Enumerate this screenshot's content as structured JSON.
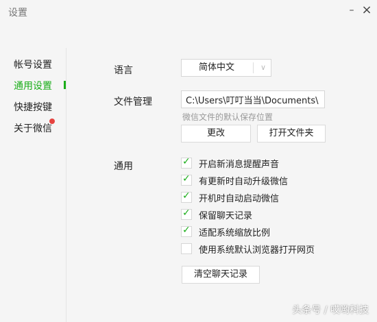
{
  "window": {
    "title": "设置",
    "minimize_glyph": "–",
    "close_glyph": "×"
  },
  "sidebar": {
    "items": [
      {
        "label": "帐号设置"
      },
      {
        "label": "通用设置"
      },
      {
        "label": "快捷按键"
      },
      {
        "label": "关于微信"
      }
    ],
    "active_index": 1
  },
  "language": {
    "label": "语言",
    "selected": "简体中文",
    "arrow_glyph": "∨"
  },
  "file_management": {
    "label": "文件管理",
    "path_value": "C:\\Users\\叮叮当当\\Documents\\",
    "hint": "微信文件的默认保存位置",
    "change_button": "更改",
    "open_folder_button": "打开文件夹"
  },
  "general": {
    "label": "通用",
    "options": [
      {
        "label": "开启新消息提醒声音",
        "checked": true
      },
      {
        "label": "有更新时自动升级微信",
        "checked": true
      },
      {
        "label": "开机时自动启动微信",
        "checked": true
      },
      {
        "label": "保留聊天记录",
        "checked": true
      },
      {
        "label": "适配系统缩放比例",
        "checked": true
      },
      {
        "label": "使用系统默认浏览器打开网页",
        "checked": false
      }
    ],
    "clear_button": "清空聊天记录"
  },
  "watermark": "头条号 / 哎哟科技",
  "colors": {
    "accent": "#1aad19",
    "badge": "#e64340"
  }
}
